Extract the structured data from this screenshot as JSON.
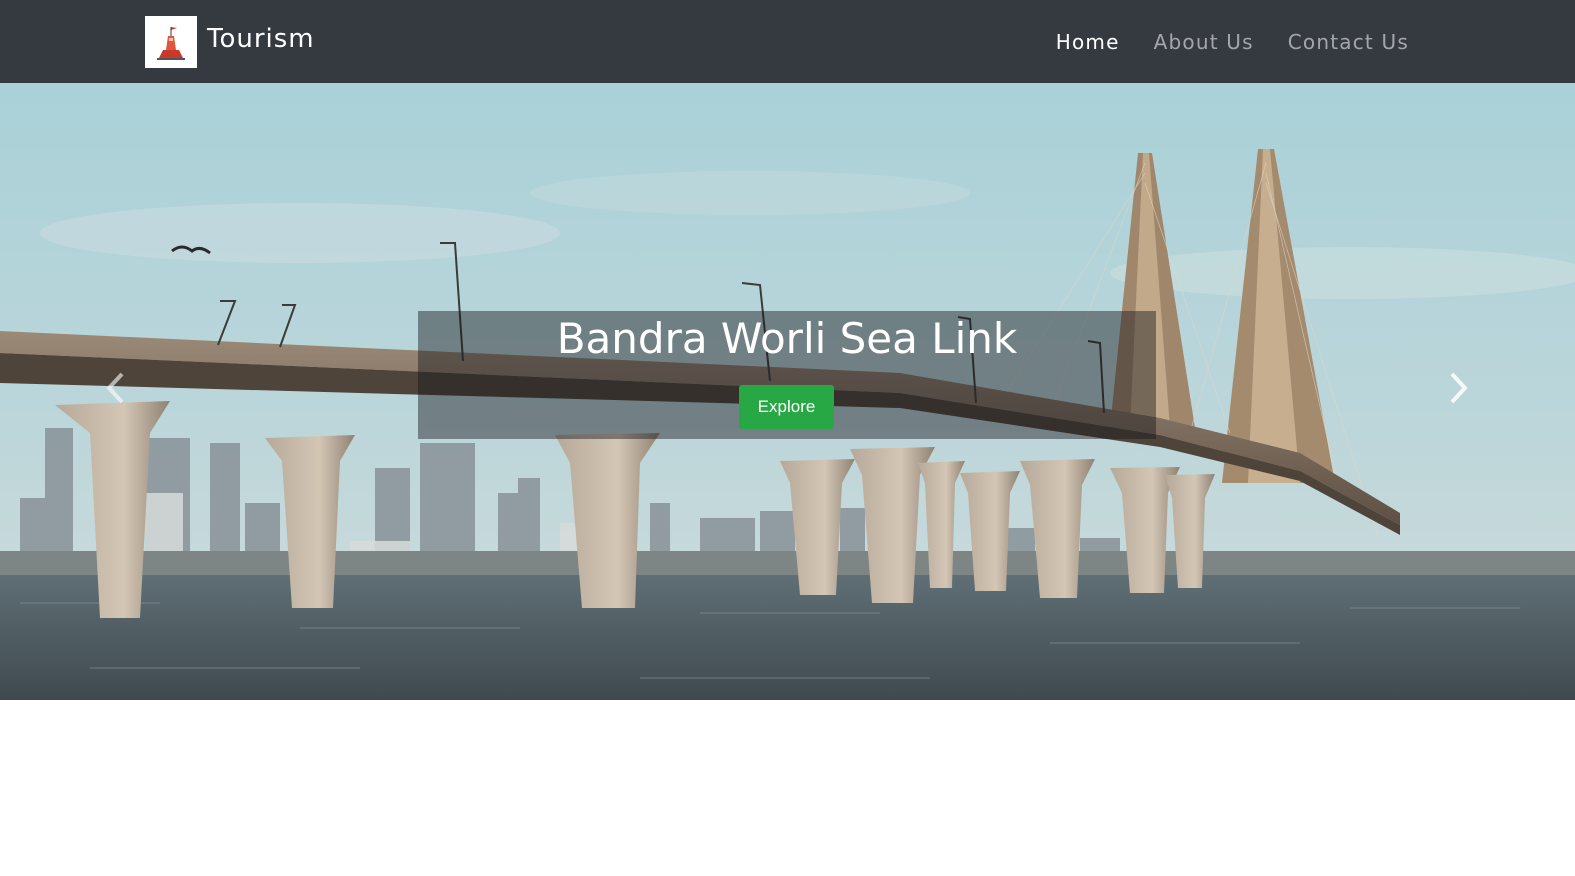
{
  "navbar": {
    "brand": "Tourism",
    "links": [
      {
        "label": "Home",
        "active": true
      },
      {
        "label": "About Us",
        "active": false
      },
      {
        "label": "Contact Us",
        "active": false
      }
    ]
  },
  "carousel": {
    "slide_title": "Bandra Worli Sea Link",
    "button_label": "Explore",
    "prev_icon": "chevron-left-icon",
    "next_icon": "chevron-right-icon"
  },
  "colors": {
    "navbar_bg": "#343a40",
    "button_green": "#28a745"
  }
}
